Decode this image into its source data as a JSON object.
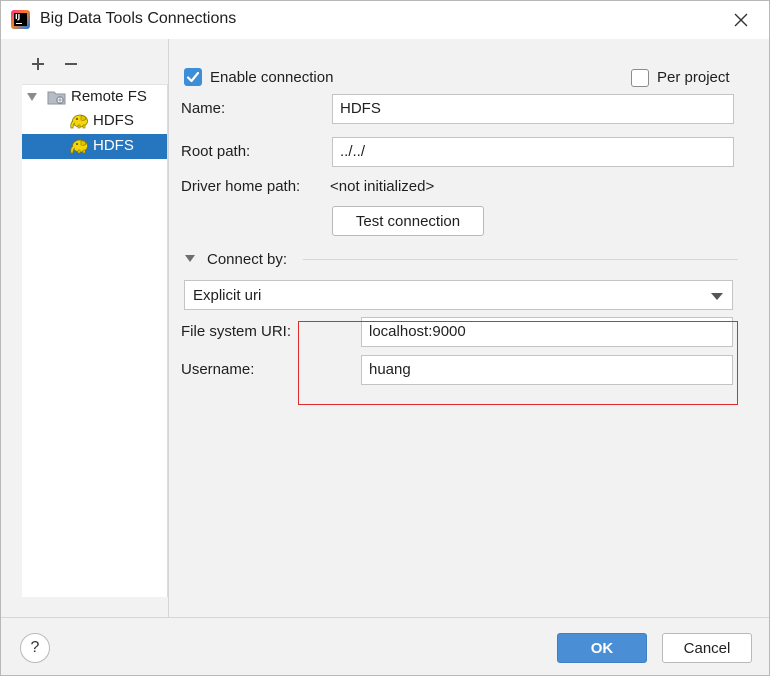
{
  "window": {
    "title": "Big Data Tools Connections",
    "icons": {
      "app": "intellij-idea-icon",
      "close": "close-icon"
    }
  },
  "left_panel": {
    "toolbar": {
      "add_label": "+",
      "remove_label": "−"
    },
    "tree": {
      "group_label": "Remote FS",
      "group_icon": "remote-folder-icon",
      "items": [
        {
          "label": "HDFS",
          "icon": "hadoop-elephant-icon",
          "selected": false
        },
        {
          "label": "HDFS",
          "icon": "hadoop-elephant-icon",
          "selected": true
        }
      ]
    }
  },
  "form": {
    "enable_connection": {
      "label": "Enable connection",
      "checked": true
    },
    "per_project": {
      "label": "Per project",
      "checked": false
    },
    "name": {
      "label": "Name:",
      "value": "HDFS"
    },
    "root_path": {
      "label": "Root path:",
      "value": "../../"
    },
    "driver_home": {
      "label": "Driver home path:",
      "value": "<not initialized>"
    },
    "test_connection_label": "Test connection",
    "connect_by": {
      "label": "Connect by:",
      "selected": "Explicit uri"
    },
    "file_system_uri": {
      "label": "File system URI:",
      "value": "localhost:9000"
    },
    "username": {
      "label": "Username:",
      "value": "huang"
    }
  },
  "footer": {
    "help_label": "?",
    "ok_label": "OK",
    "cancel_label": "Cancel"
  },
  "colors": {
    "selection": "#2675bf",
    "checkbox_checked": "#3d8ed8",
    "ok_button": "#4a8fd6",
    "annotation_rect": "#e02b2b",
    "hadoop_yellow": "#f5d60a"
  }
}
